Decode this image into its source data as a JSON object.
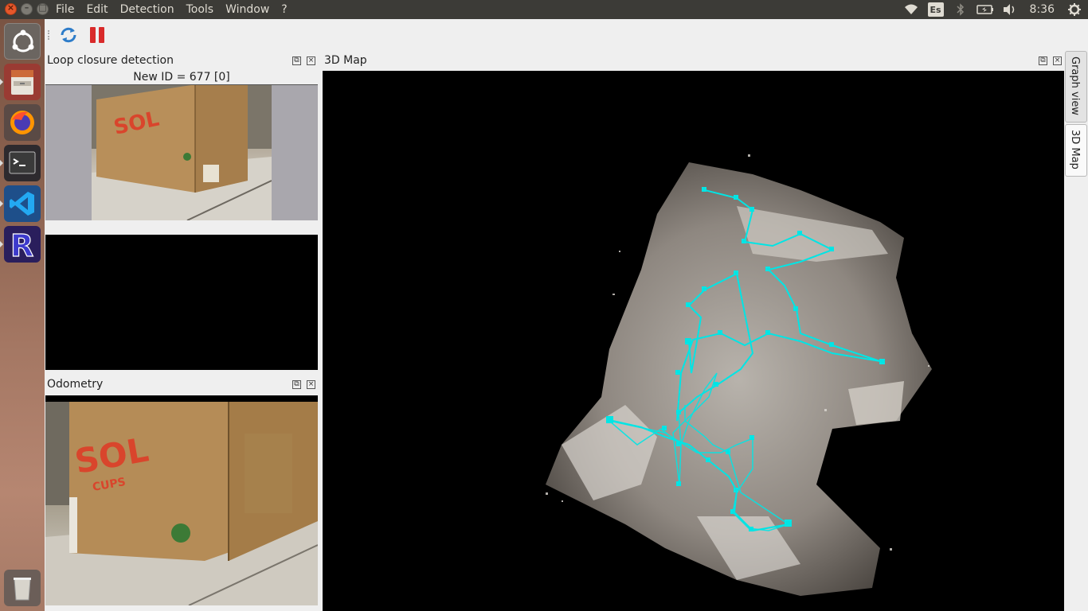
{
  "menubar": {
    "items": [
      "File",
      "Edit",
      "Detection",
      "Tools",
      "Window",
      "?"
    ]
  },
  "tray": {
    "keyboard_layout": "Es",
    "clock": "8:36"
  },
  "docks": {
    "loop_closure": {
      "title": "Loop closure detection",
      "new_id_label": "New ID = 677 [0]"
    },
    "odometry": {
      "title": "Odometry"
    },
    "map3d": {
      "title": "3D Map"
    }
  },
  "right_tabs": [
    "Graph view",
    "3D Map"
  ],
  "photo_text": {
    "brand": "SOL",
    "subbrand": "CUPS"
  },
  "colors": {
    "graph_path": "#00e5e5",
    "top_panel": "#3c3b37",
    "close_button": "#e5572b"
  }
}
